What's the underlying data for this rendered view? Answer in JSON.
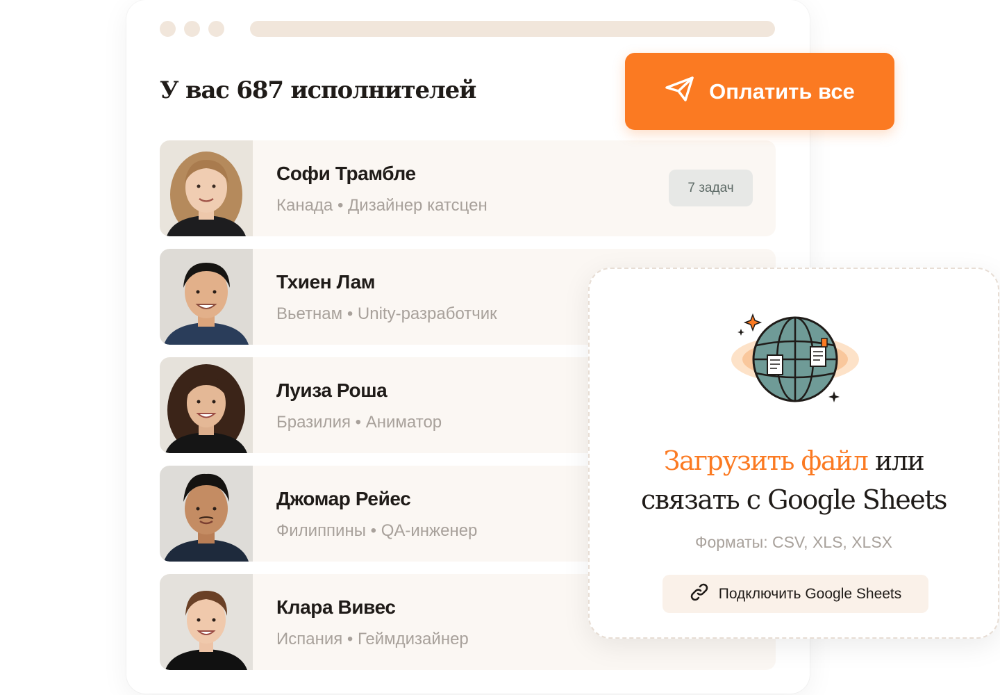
{
  "header": {
    "title": "У вас 687 исполнителей",
    "pay_button_label": "Оплатить все"
  },
  "contractors": [
    {
      "name": "Софи Трамбле",
      "country": "Канада",
      "role": "Дизайнер катсцен",
      "separator": "•",
      "badge": "7 задач"
    },
    {
      "name": "Тхиен Лам",
      "country": "Вьетнам",
      "role": "Unity-разработчик",
      "separator": "•"
    },
    {
      "name": "Луиза Роша",
      "country": "Бразилия",
      "role": "Аниматор",
      "separator": "•"
    },
    {
      "name": "Джомар Рейес",
      "country": "Филиппины",
      "role": "QA-инженер",
      "separator": "•"
    },
    {
      "name": "Клара Вивес",
      "country": "Испания",
      "role": "Геймдизайнер",
      "separator": "•"
    }
  ],
  "upload": {
    "title_accent": "Загрузить файл",
    "title_rest_1": " или",
    "title_rest_2": "связать с Google Sheets",
    "formats": "Форматы: CSV, XLS, XLSX",
    "connect_button_label": "Подключить Google Sheets"
  },
  "colors": {
    "accent": "#fb7a22",
    "row_bg": "#fbf7f3",
    "muted_text": "#a8a19b",
    "badge_bg": "#e7e8e6",
    "window_chrome": "#f1e6db"
  },
  "icons": {
    "pay": "paper-plane-icon",
    "connect": "link-icon",
    "upload": "globe-with-documents-icon"
  }
}
